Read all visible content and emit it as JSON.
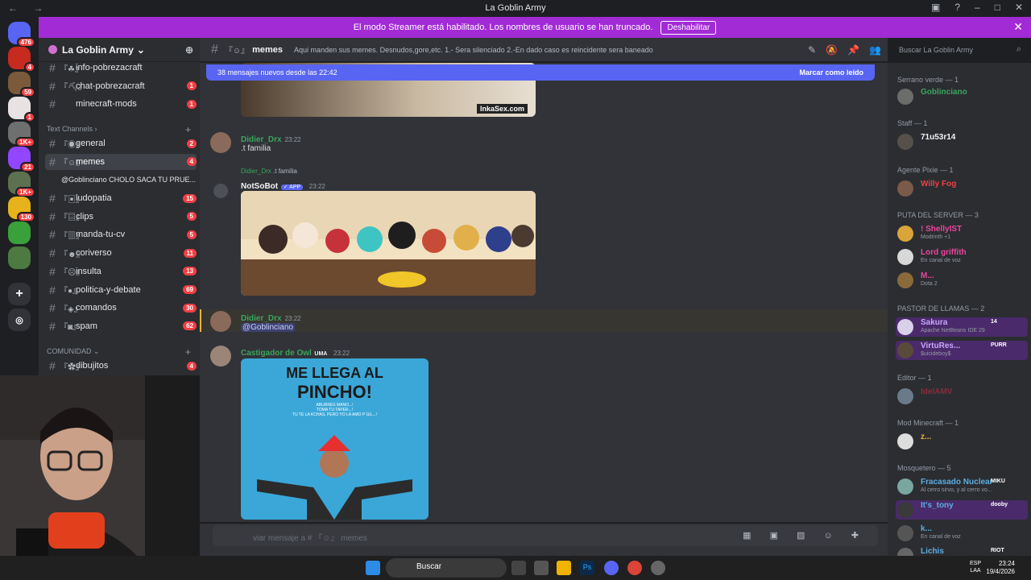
{
  "titlebar": {
    "title": "La Goblin Army",
    "nav": "←  →"
  },
  "banner": {
    "text": "El modo Streamer está habilitado. Los nombres de usuario se han truncado.",
    "button": "Deshabilitar",
    "close": "✕"
  },
  "rail": {
    "servers": [
      {
        "label": "476",
        "color": "#5865f2",
        "badge": "476"
      },
      {
        "label": "",
        "color": "#c72a1f",
        "badge": "4"
      },
      {
        "label": "",
        "color": "#7a5a3a",
        "badge": "59"
      },
      {
        "label": "",
        "color": "#e8e2e2",
        "badge": "1"
      },
      {
        "label": "",
        "color": "#6f6f6f",
        "badge": "1K+"
      },
      {
        "label": "",
        "color": "#9146ff",
        "badge": "21"
      },
      {
        "label": "",
        "color": "#5d7050",
        "badge": "1K+"
      },
      {
        "label": "",
        "color": "#e6b31c",
        "badge": "130"
      },
      {
        "label": "",
        "color": "#3aa03a",
        "badge": ""
      },
      {
        "label": "",
        "color": "#4d7a40",
        "badge": ""
      }
    ]
  },
  "sidebar": {
    "guild": "La Goblin Army",
    "channels_top": [
      {
        "emoji": "『☘』",
        "name": "info-pobrezacraft",
        "count": ""
      },
      {
        "emoji": "『⛏』",
        "name": "chat-pobrezacraft",
        "count": "1"
      },
      {
        "emoji": "",
        "name": "minecraft-mods",
        "count": "1"
      }
    ],
    "cat_text": "Text Channels",
    "channels_text": [
      {
        "emoji": "『◉』",
        "name": "general",
        "count": "2"
      },
      {
        "emoji": "『☺』",
        "name": "memes",
        "count": "4"
      }
    ],
    "thread": "@Goblinciano CHOLO SACA TU PRUE...",
    "channels_text2": [
      {
        "emoji": "『▣』",
        "name": "ludopatia",
        "count": "15"
      },
      {
        "emoji": "『▤』",
        "name": "clips",
        "count": "5"
      },
      {
        "emoji": "『▥』",
        "name": "manda-tu-cv",
        "count": "5"
      },
      {
        "emoji": "『☻』",
        "name": "coriverso",
        "count": "11"
      },
      {
        "emoji": "『☹』",
        "name": "insulta",
        "count": "13"
      },
      {
        "emoji": "『●』",
        "name": "politica-y-debate",
        "count": "69"
      },
      {
        "emoji": "『◈』",
        "name": "comandos",
        "count": "30"
      },
      {
        "emoji": "『◙』",
        "name": "spam",
        "count": "62"
      }
    ],
    "cat_comunidad": "COMUNIDAD",
    "channels_com": [
      {
        "emoji": "『✿』",
        "name": "dibujitos",
        "count": "4"
      }
    ]
  },
  "header": {
    "channel": "memes",
    "emoji": "『☺』",
    "topic": "Aqui manden sus memes. Desnudos,gore,etc. 1.- Sera silenciado 2.-En dado caso es reincidente sera baneado",
    "search": "Buscar La Goblin Army"
  },
  "chat": {
    "newbar": "38 mensajes nuevos desde las 22:42",
    "mark_read": "Marcar como leído",
    "img1_watermark": "InkaSex.com",
    "msg1": {
      "user": "Didier_Drx",
      "time": "23:22",
      "text": ".t familia"
    },
    "reply": {
      "user": "Didier_Drx",
      "text": ".t familia"
    },
    "msg2": {
      "user": "NotSoBot",
      "tag": "✓ APP",
      "time": "23:22"
    },
    "msg3": {
      "user": "Didier_Drx",
      "time": "23:22",
      "mention": "@Goblinciano"
    },
    "msg4": {
      "user": "Castigador de Owl",
      "tag": "UMA",
      "time": "23:22"
    },
    "meme": {
      "line1": "ME LLEGA AL",
      "line2": "PINCHO!",
      "small1": "ABURRES MANO...!",
      "small2": "TOMA  TU  TAPER...!",
      "small3": "TU TE LA KCHAS, PERO YO LA AMO P GIL...!"
    }
  },
  "composer": {
    "placeholder": "viar mensaje a # 『☺』 memes",
    "icons": "▦ ▣ ▨ ☺ ✚"
  },
  "members": {
    "roles": [
      {
        "name": "Serrano verde — 1"
      },
      {
        "name": "Staff — 1"
      },
      {
        "name": "Agente Pixie — 1"
      },
      {
        "name": "PUTA DEL SERVER — 3"
      },
      {
        "name": "PASTOR DE LLAMAS — 2"
      },
      {
        "name": "Editor — 1"
      },
      {
        "name": "Mod Minecraft — 1"
      },
      {
        "name": "Mosquetero — 5"
      }
    ],
    "list": [
      {
        "name": "Goblinciano",
        "status": "",
        "color": "#3ba55d"
      },
      {
        "name": "71u53r14",
        "status": "",
        "color": "#f2f3f5"
      },
      {
        "name": "Willy Fog",
        "status": "",
        "color": "#ed4245"
      },
      {
        "name": "! ShellyIST",
        "status": "Modrinth +1",
        "color": "#eb459e"
      },
      {
        "name": "Lord griffith",
        "status": "En canal de voz",
        "color": "#eb459e"
      },
      {
        "name": "M...",
        "status": "Dota 2",
        "color": "#eb459e"
      },
      {
        "name": "Sakura",
        "status": "Apache NetBeans IDE 29",
        "color": "#c9a7ff",
        "tag": "14"
      },
      {
        "name": "VirtuRes...",
        "status": "$uicideboy$",
        "color": "#c9a7ff",
        "tag": "PURR"
      },
      {
        "name": "IdelAMV",
        "status": "",
        "color": "#8b2b3d"
      },
      {
        "name": "z...",
        "status": "",
        "color": "#f0b232"
      },
      {
        "name": "Fracasado Nuclear",
        "status": "Al cerro sirvo, y al cerro vo...",
        "color": "#5dade2",
        "tag": "MIKU"
      },
      {
        "name": "It's_tony",
        "status": "",
        "color": "#5dade2",
        "tag": "dooby"
      },
      {
        "name": "k...",
        "status": "En canal de voz",
        "color": "#5dade2"
      },
      {
        "name": "Lichis",
        "status": "",
        "color": "#5dade2",
        "tag": "RIOT"
      }
    ]
  },
  "taskbar": {
    "search": "Buscar",
    "lang1": "ESP",
    "lang2": "LAA",
    "time": "23:24",
    "date": "19/4/2026"
  }
}
